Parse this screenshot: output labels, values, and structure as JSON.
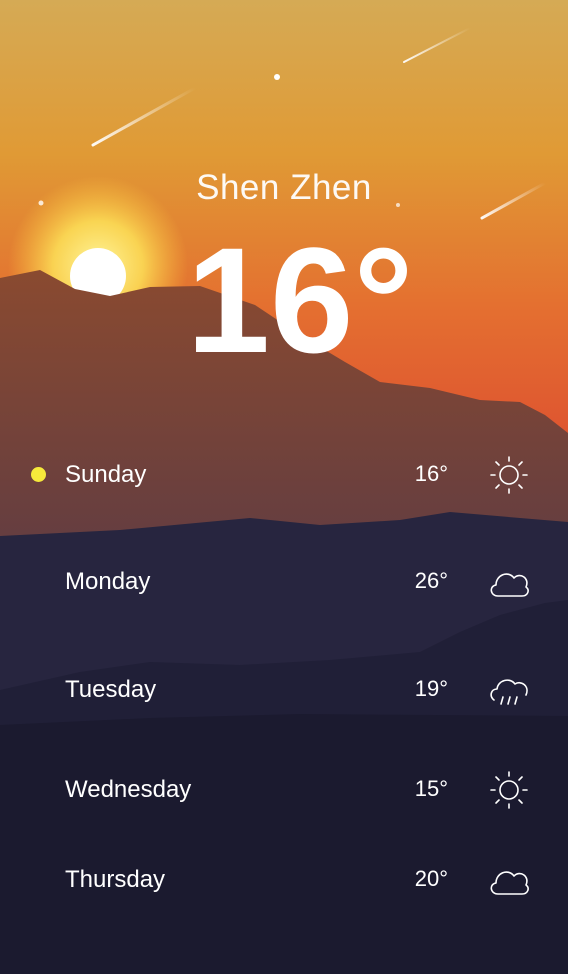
{
  "location": {
    "city": "Shen Zhen"
  },
  "current": {
    "temperature": "16°"
  },
  "colors": {
    "sky_top": "#d6a94c",
    "sky_bottom": "#df5a2e",
    "sun": "#ffffff",
    "night": "#1b1a2e",
    "selected_dot": "#f6e93b"
  },
  "forecast": [
    {
      "day": "Sunday",
      "temp": "16°",
      "icon": "sun-icon",
      "selected": true
    },
    {
      "day": "Monday",
      "temp": "26°",
      "icon": "cloud-icon",
      "selected": false
    },
    {
      "day": "Tuesday",
      "temp": "19°",
      "icon": "rain-cloud-icon",
      "selected": false
    },
    {
      "day": "Wednesday",
      "temp": "15°",
      "icon": "sun-icon",
      "selected": false
    },
    {
      "day": "Thursday",
      "temp": "20°",
      "icon": "cloud-icon",
      "selected": false
    }
  ]
}
